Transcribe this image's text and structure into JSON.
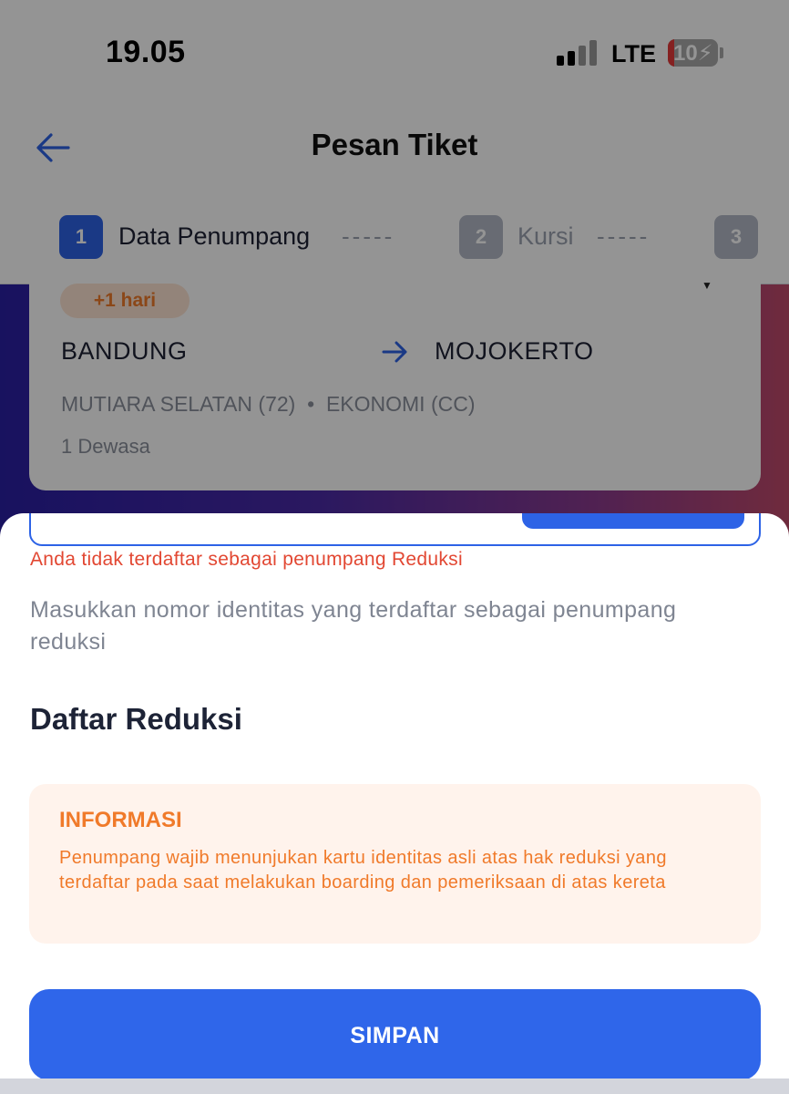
{
  "status_bar": {
    "time": "19.05",
    "network": "LTE",
    "battery": "10",
    "battery_color": "#e53a3a"
  },
  "header": {
    "title": "Pesan Tiket"
  },
  "steps": [
    {
      "number": "1",
      "label": "Data Penumpang",
      "state": "active"
    },
    {
      "number": "2",
      "label": "Kursi",
      "state": "inactive"
    },
    {
      "number": "3",
      "label": "",
      "state": "inactive"
    }
  ],
  "step_separator": "-----",
  "trip": {
    "day_badge": "+1 hari",
    "origin": "BANDUNG",
    "destination": "MOJOKERTO",
    "train": "MUTIARA SELATAN (72)",
    "separator": "•",
    "class": "EKONOMI (CC)",
    "passengers": "1 Dewasa"
  },
  "sheet": {
    "error": "Anda tidak terdaftar sebagai penumpang Reduksi",
    "helper": "Masukkan nomor identitas yang terdaftar sebagai penumpang reduksi",
    "section_title": "Daftar Reduksi",
    "info": {
      "title": "INFORMASI",
      "body": "Penumpang wajib menunjukan kartu identitas asli atas hak reduksi yang terdaftar pada saat melakukan boarding dan pemeriksaan di atas kereta"
    },
    "save_label": "SIMPAN"
  },
  "colors": {
    "accent": "#2d63e6",
    "error": "#e24732",
    "warning": "#f07a2a",
    "info_bg": "#fff3ec"
  }
}
